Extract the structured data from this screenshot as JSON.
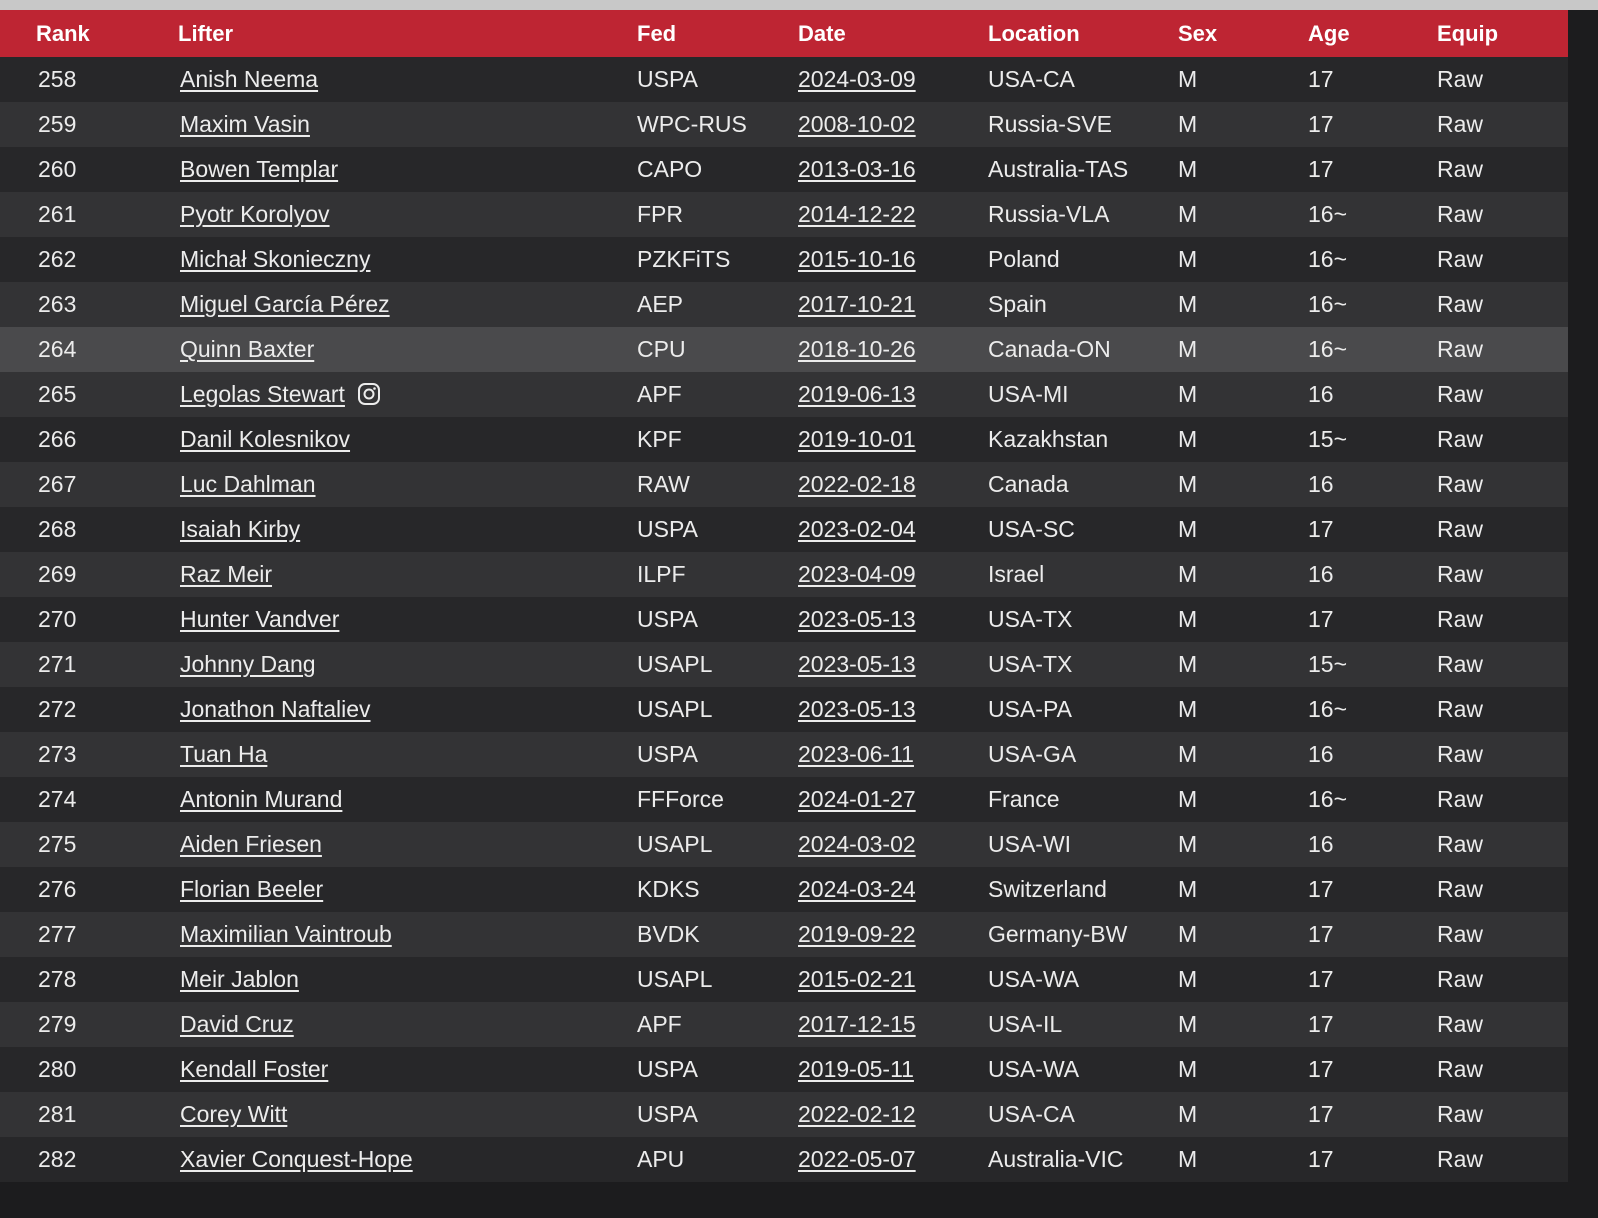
{
  "columns": {
    "rank": "Rank",
    "lifter": "Lifter",
    "fed": "Fed",
    "date": "Date",
    "location": "Location",
    "sex": "Sex",
    "age": "Age",
    "equip": "Equip"
  },
  "colors": {
    "header_bg": "#be2533",
    "row_dark": "#272729",
    "row_light": "#333335",
    "row_highlight": "#4a4a4c",
    "text": "#ececec"
  },
  "rows": [
    {
      "rank": "258",
      "lifter": "Anish Neema",
      "fed": "USPA",
      "date": "2024-03-09",
      "location": "USA-CA",
      "sex": "M",
      "age": "17",
      "equip": "Raw"
    },
    {
      "rank": "259",
      "lifter": "Maxim Vasin",
      "fed": "WPC-RUS",
      "date": "2008-10-02",
      "location": "Russia-SVE",
      "sex": "M",
      "age": "17",
      "equip": "Raw"
    },
    {
      "rank": "260",
      "lifter": "Bowen Templar",
      "fed": "CAPO",
      "date": "2013-03-16",
      "location": "Australia-TAS",
      "sex": "M",
      "age": "17",
      "equip": "Raw"
    },
    {
      "rank": "261",
      "lifter": "Pyotr Korolyov",
      "fed": "FPR",
      "date": "2014-12-22",
      "location": "Russia-VLA",
      "sex": "M",
      "age": "16~",
      "equip": "Raw"
    },
    {
      "rank": "262",
      "lifter": "Michał Skonieczny",
      "fed": "PZKFiTS",
      "date": "2015-10-16",
      "location": "Poland",
      "sex": "M",
      "age": "16~",
      "equip": "Raw"
    },
    {
      "rank": "263",
      "lifter": "Miguel García Pérez",
      "fed": "AEP",
      "date": "2017-10-21",
      "location": "Spain",
      "sex": "M",
      "age": "16~",
      "equip": "Raw"
    },
    {
      "rank": "264",
      "lifter": "Quinn Baxter",
      "fed": "CPU",
      "date": "2018-10-26",
      "location": "Canada-ON",
      "sex": "M",
      "age": "16~",
      "equip": "Raw",
      "highlighted": true
    },
    {
      "rank": "265",
      "lifter": "Legolas Stewart",
      "fed": "APF",
      "date": "2019-06-13",
      "location": "USA-MI",
      "sex": "M",
      "age": "16",
      "equip": "Raw",
      "icon": "instagram-icon"
    },
    {
      "rank": "266",
      "lifter": "Danil Kolesnikov",
      "fed": "KPF",
      "date": "2019-10-01",
      "location": "Kazakhstan",
      "sex": "M",
      "age": "15~",
      "equip": "Raw"
    },
    {
      "rank": "267",
      "lifter": "Luc Dahlman",
      "fed": "RAW",
      "date": "2022-02-18",
      "location": "Canada",
      "sex": "M",
      "age": "16",
      "equip": "Raw"
    },
    {
      "rank": "268",
      "lifter": "Isaiah Kirby",
      "fed": "USPA",
      "date": "2023-02-04",
      "location": "USA-SC",
      "sex": "M",
      "age": "17",
      "equip": "Raw"
    },
    {
      "rank": "269",
      "lifter": "Raz Meir",
      "fed": "ILPF",
      "date": "2023-04-09",
      "location": "Israel",
      "sex": "M",
      "age": "16",
      "equip": "Raw"
    },
    {
      "rank": "270",
      "lifter": "Hunter Vandver",
      "fed": "USPA",
      "date": "2023-05-13",
      "location": "USA-TX",
      "sex": "M",
      "age": "17",
      "equip": "Raw"
    },
    {
      "rank": "271",
      "lifter": "Johnny Dang",
      "fed": "USAPL",
      "date": "2023-05-13",
      "location": "USA-TX",
      "sex": "M",
      "age": "15~",
      "equip": "Raw"
    },
    {
      "rank": "272",
      "lifter": "Jonathon Naftaliev",
      "fed": "USAPL",
      "date": "2023-05-13",
      "location": "USA-PA",
      "sex": "M",
      "age": "16~",
      "equip": "Raw"
    },
    {
      "rank": "273",
      "lifter": "Tuan Ha",
      "fed": "USPA",
      "date": "2023-06-11",
      "location": "USA-GA",
      "sex": "M",
      "age": "16",
      "equip": "Raw"
    },
    {
      "rank": "274",
      "lifter": "Antonin Murand",
      "fed": "FFForce",
      "date": "2024-01-27",
      "location": "France",
      "sex": "M",
      "age": "16~",
      "equip": "Raw"
    },
    {
      "rank": "275",
      "lifter": "Aiden Friesen",
      "fed": "USAPL",
      "date": "2024-03-02",
      "location": "USA-WI",
      "sex": "M",
      "age": "16",
      "equip": "Raw"
    },
    {
      "rank": "276",
      "lifter": "Florian Beeler",
      "fed": "KDKS",
      "date": "2024-03-24",
      "location": "Switzerland",
      "sex": "M",
      "age": "17",
      "equip": "Raw"
    },
    {
      "rank": "277",
      "lifter": "Maximilian Vaintroub",
      "fed": "BVDK",
      "date": "2019-09-22",
      "location": "Germany-BW",
      "sex": "M",
      "age": "17",
      "equip": "Raw"
    },
    {
      "rank": "278",
      "lifter": "Meir Jablon",
      "fed": "USAPL",
      "date": "2015-02-21",
      "location": "USA-WA",
      "sex": "M",
      "age": "17",
      "equip": "Raw"
    },
    {
      "rank": "279",
      "lifter": "David Cruz",
      "fed": "APF",
      "date": "2017-12-15",
      "location": "USA-IL",
      "sex": "M",
      "age": "17",
      "equip": "Raw"
    },
    {
      "rank": "280",
      "lifter": "Kendall Foster",
      "fed": "USPA",
      "date": "2019-05-11",
      "location": "USA-WA",
      "sex": "M",
      "age": "17",
      "equip": "Raw"
    },
    {
      "rank": "281",
      "lifter": "Corey Witt",
      "fed": "USPA",
      "date": "2022-02-12",
      "location": "USA-CA",
      "sex": "M",
      "age": "17",
      "equip": "Raw"
    },
    {
      "rank": "282",
      "lifter": "Xavier Conquest-Hope",
      "fed": "APU",
      "date": "2022-05-07",
      "location": "Australia-VIC",
      "sex": "M",
      "age": "17",
      "equip": "Raw"
    }
  ]
}
